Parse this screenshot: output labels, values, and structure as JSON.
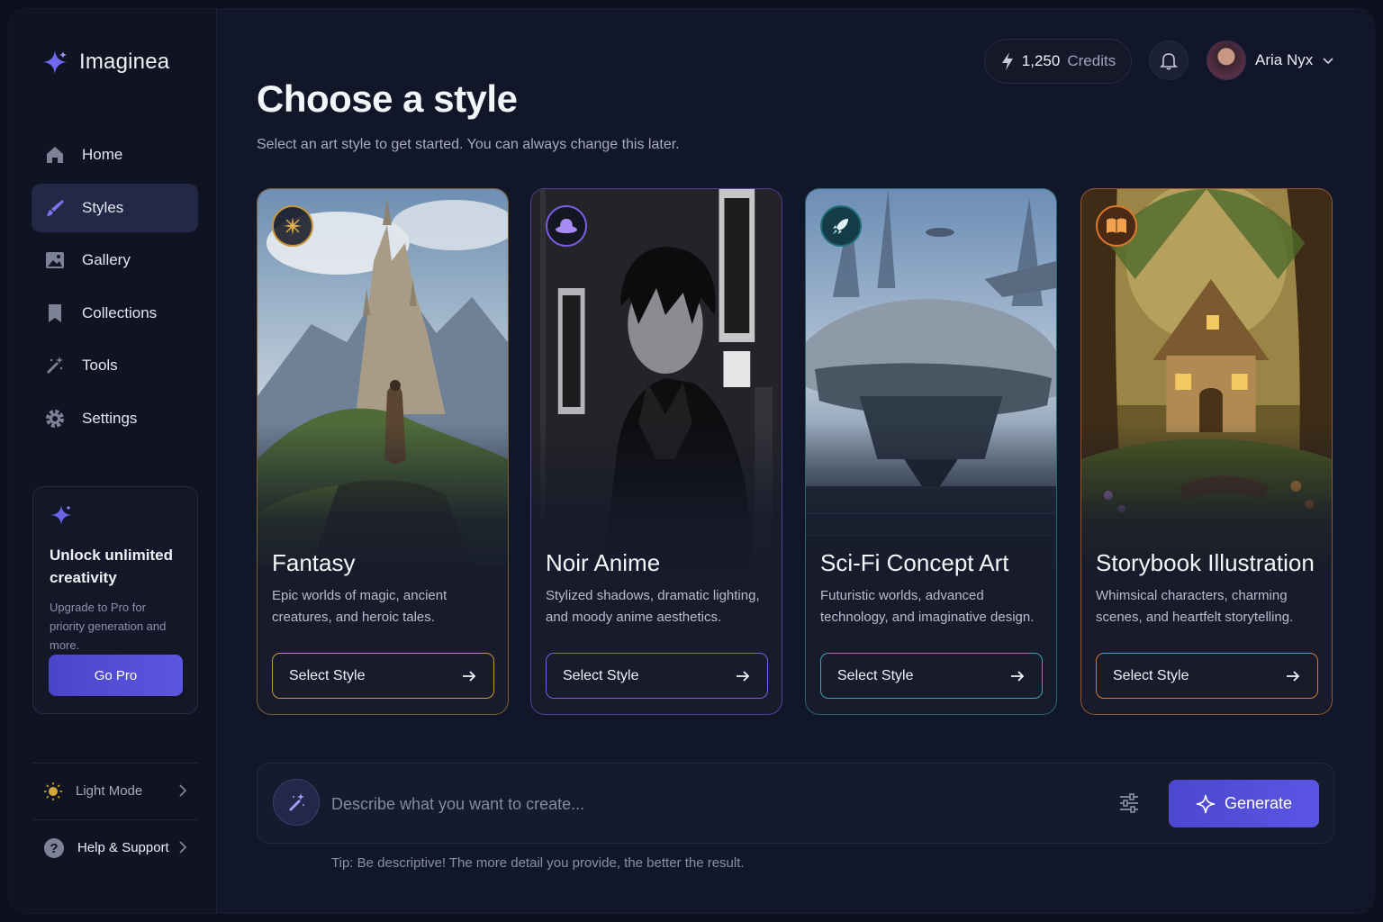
{
  "brand": {
    "name": "Imaginea"
  },
  "sidebar": {
    "items": [
      {
        "label": "Home",
        "icon": "home-icon"
      },
      {
        "label": "Styles",
        "icon": "brush-icon",
        "active": true
      },
      {
        "label": "Gallery",
        "icon": "image-icon"
      },
      {
        "label": "Collections",
        "icon": "bookmark-icon"
      },
      {
        "label": "Tools",
        "icon": "tools-icon"
      },
      {
        "label": "Settings",
        "icon": "gear-icon"
      }
    ],
    "promo": {
      "title": "Unlock unlimited creativity",
      "subtitle": "Upgrade to Pro for priority generation and more.",
      "button": "Go Pro"
    },
    "light_mode": "Light Mode",
    "help": "Help & Support"
  },
  "header": {
    "credits_value": "1,250",
    "credits_label": "Credits",
    "user_name": "Aria Nyx"
  },
  "page": {
    "title": "Choose a style",
    "subtitle": "Select an art style to get started. You can always change this later."
  },
  "cards": [
    {
      "title": "Fantasy",
      "description": "Epic worlds of magic, ancient creatures, and heroic tales.",
      "button": "Select Style",
      "accent": "#c8963c",
      "icon": "sparkle-icon"
    },
    {
      "title": "Noir Anime",
      "description": "Stylized shadows, dramatic lighting, and moody anime aesthetics.",
      "button": "Select Style",
      "accent": "#7c5ce0",
      "icon": "hat-icon"
    },
    {
      "title": "Sci-Fi Concept Art",
      "description": "Futuristic worlds, advanced technology, and imaginative design.",
      "button": "Select Style",
      "accent": "#3aa6b0",
      "icon": "rocket-icon"
    },
    {
      "title": "Storybook Illustration",
      "description": "Whimsical characters, charming scenes, and heartfelt storytelling.",
      "button": "Select Style",
      "accent": "#d9772e",
      "icon": "book-icon"
    }
  ],
  "prompt": {
    "placeholder": "Describe what you want to create...",
    "generate": "Generate",
    "tip": "Tip: Be descriptive! The more detail you provide, the better the result."
  },
  "colors": {
    "accent": "#5550dc",
    "background": "#121629"
  }
}
